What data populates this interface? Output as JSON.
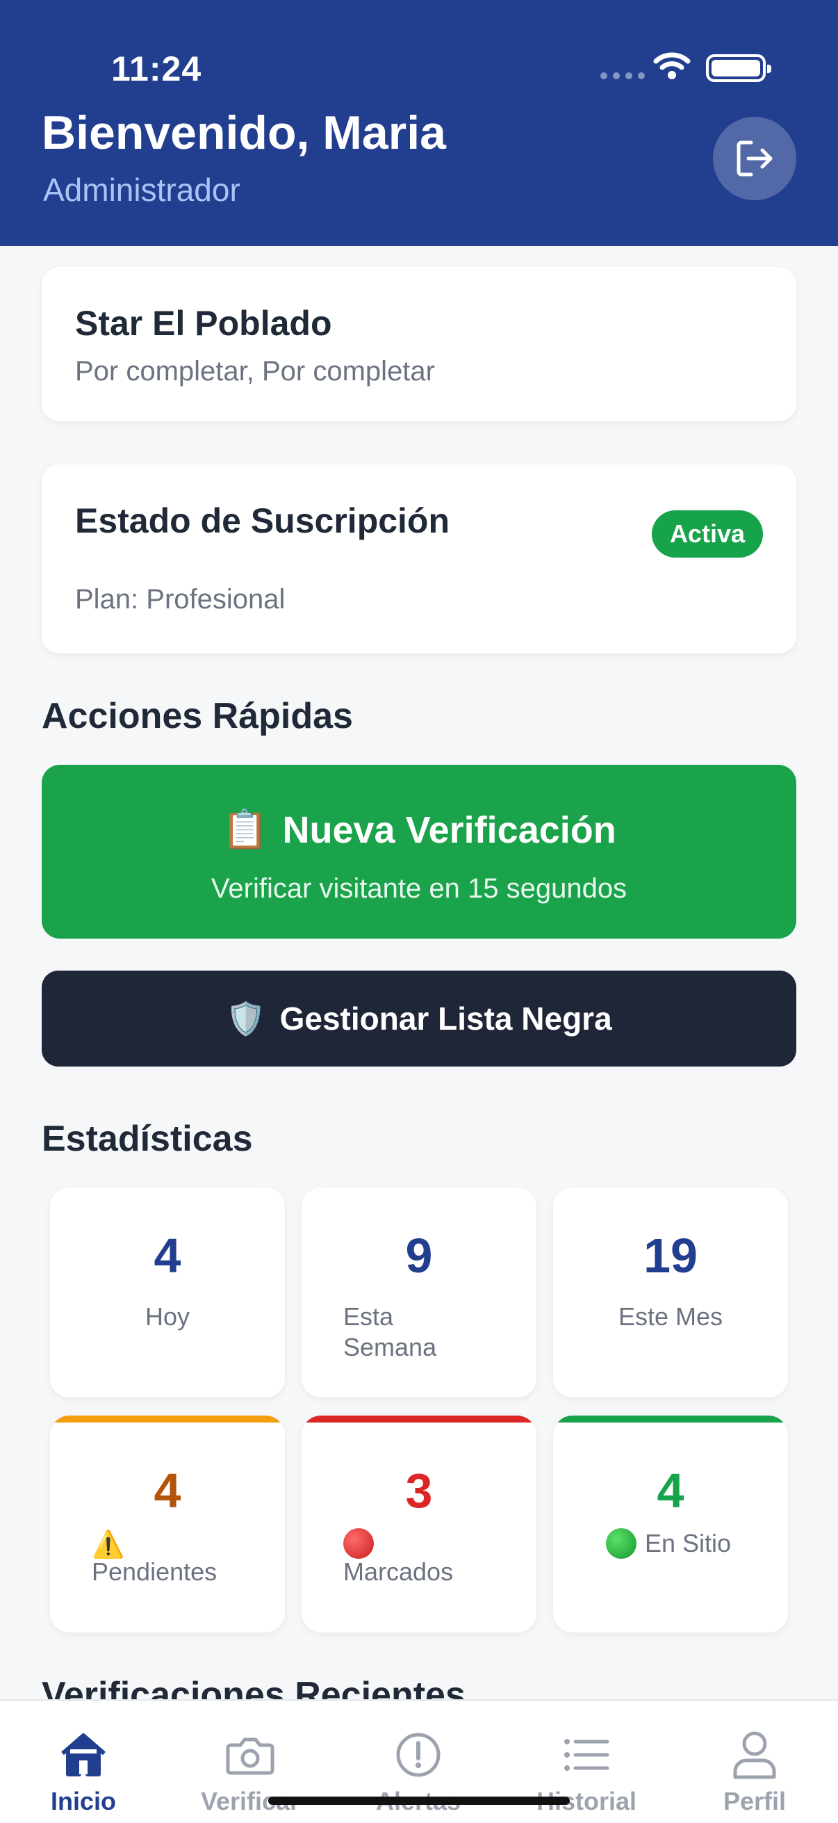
{
  "status_bar": {
    "time": "11:24"
  },
  "header": {
    "greeting": "Bienvenido, Maria",
    "role": "Administrador"
  },
  "site_card": {
    "name": "Star El Poblado",
    "address": "Por completar, Por completar"
  },
  "subscription": {
    "title": "Estado de Suscripción",
    "badge": "Activa",
    "plan": "Plan: Profesional"
  },
  "quick_actions": {
    "title": "Acciones Rápidas",
    "verify": {
      "icon": "📋",
      "label": "Nueva Verificación",
      "sub": "Verificar visitante en 15 segundos"
    },
    "blacklist": {
      "icon": "🛡️",
      "label": "Gestionar Lista Negra"
    }
  },
  "stats": {
    "title": "Estadísticas",
    "today": {
      "value": "4",
      "label": "Hoy"
    },
    "week": {
      "value": "9",
      "label": "Esta Semana"
    },
    "month": {
      "value": "19",
      "label": "Este Mes"
    },
    "pending": {
      "value": "4",
      "icon": "⚠️",
      "label": "Pendientes"
    },
    "flagged": {
      "value": "3",
      "label": "Marcados"
    },
    "onsite": {
      "value": "4",
      "label": "En Sitio"
    }
  },
  "recent": {
    "title": "Verificaciones Recientes"
  },
  "tabbar": {
    "items": [
      {
        "label": "Inicio",
        "icon": "home-icon",
        "active": true
      },
      {
        "label": "Verificar",
        "icon": "camera-icon"
      },
      {
        "label": "Alertas",
        "icon": "alert-icon"
      },
      {
        "label": "Historial",
        "icon": "list-icon"
      },
      {
        "label": "Perfil",
        "icon": "user-icon"
      }
    ]
  },
  "colors": {
    "header": "#223e8f",
    "primary_green": "#1aa34b",
    "dark_button": "#1f2638",
    "navy_number": "#223e8f",
    "pending": "#b45309",
    "flagged": "#dc2626",
    "onsite": "#16a34a"
  }
}
